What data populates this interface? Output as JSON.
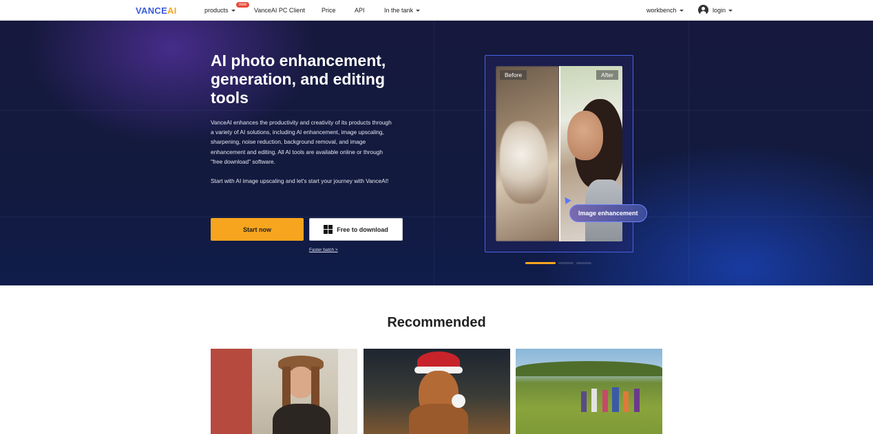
{
  "nav": {
    "logo_main": "VANCE",
    "logo_accent": "AI",
    "items": [
      {
        "label": "products",
        "has_caret": true
      },
      {
        "label": "VanceAI PC Client",
        "has_caret": false
      },
      {
        "label": "Price",
        "has_caret": false
      },
      {
        "label": "API",
        "has_caret": false
      },
      {
        "label": "In the tank",
        "has_caret": true
      }
    ],
    "new_badge": "new",
    "workbench": "workbench",
    "login": "login"
  },
  "hero": {
    "title": "AI photo enhancement, generation, and editing tools",
    "description": "VanceAI enhances the productivity and creativity of its products through a variety of AI solutions, including AI enhancement, image upscaling, sharpening, noise reduction, background removal, and image enhancement and editing. All AI tools are available online or through \"free download\" software.",
    "description2": "Start with AI image upscaling and let's start your journey with VanceAI!",
    "start_button": "Start now",
    "download_button": "Free to download",
    "faster_link": "Faster batch >",
    "before_label": "Before",
    "after_label": "After",
    "feature_badge": "Image enhancement",
    "slide_count": 3,
    "active_slide": 1
  },
  "recommended": {
    "title": "Recommended"
  },
  "colors": {
    "accent_orange": "#f7a51f",
    "brand_blue": "#3b5bdb",
    "hero_bg": "#121a3e"
  }
}
